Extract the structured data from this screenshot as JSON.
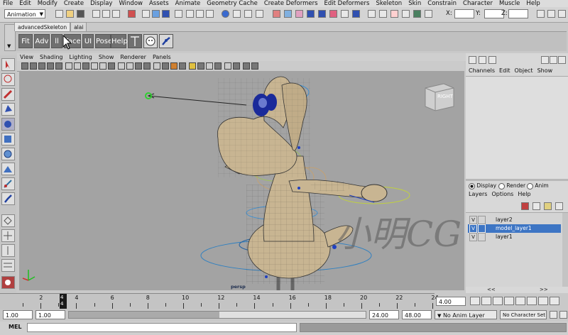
{
  "menubar": [
    "File",
    "Edit",
    "Modify",
    "Create",
    "Display",
    "Window",
    "Assets",
    "Animate",
    "Geometry Cache",
    "Create Deformers",
    "Edit Deformers",
    "Skeleton",
    "Skin",
    "Constrain",
    "Character",
    "Muscle",
    "Help"
  ],
  "status": {
    "mode": "Animation",
    "x_label": "X:",
    "y_label": "Y:",
    "z_label": "Z:"
  },
  "shelf_tabs": [
    "advancedSkeleton",
    "alai"
  ],
  "shelf_buttons": [
    "Fit",
    "Adv",
    "ll",
    "Face",
    "UI",
    "Pose",
    "Help"
  ],
  "panel_menu": [
    "View",
    "Shading",
    "Lighting",
    "Show",
    "Renderer",
    "Panels"
  ],
  "viewport": {
    "cube_label": "RIGHT",
    "camera_label": "persp",
    "watermark": "小明CG",
    "bg_color": "#a3a3a3"
  },
  "channel_menu": [
    "Channels",
    "Edit",
    "Object",
    "Show"
  ],
  "layer_mode": {
    "display": "Display",
    "render": "Render",
    "anim": "Anim"
  },
  "layer_menu": [
    "Layers",
    "Options",
    "Help"
  ],
  "layers": [
    {
      "vis": "V",
      "name": "layer2",
      "selected": false
    },
    {
      "vis": "V",
      "name": "model_layer1",
      "selected": true
    },
    {
      "vis": "V",
      "name": "layer1",
      "selected": false
    }
  ],
  "timeline": {
    "ticks": [
      "2",
      "4",
      "6",
      "8",
      "10",
      "12",
      "14",
      "16",
      "18",
      "20",
      "22",
      "24"
    ],
    "current_frame_top": "4",
    "current_frame_bottom": "4",
    "current_time": "4.00"
  },
  "range": {
    "start": "1.00",
    "start_inner": "1.00",
    "end_inner": "24.00",
    "end": "48.00",
    "anim_layer": "No Anim Layer",
    "character_set": "No Character Set"
  },
  "cmd": {
    "label": "MEL"
  }
}
